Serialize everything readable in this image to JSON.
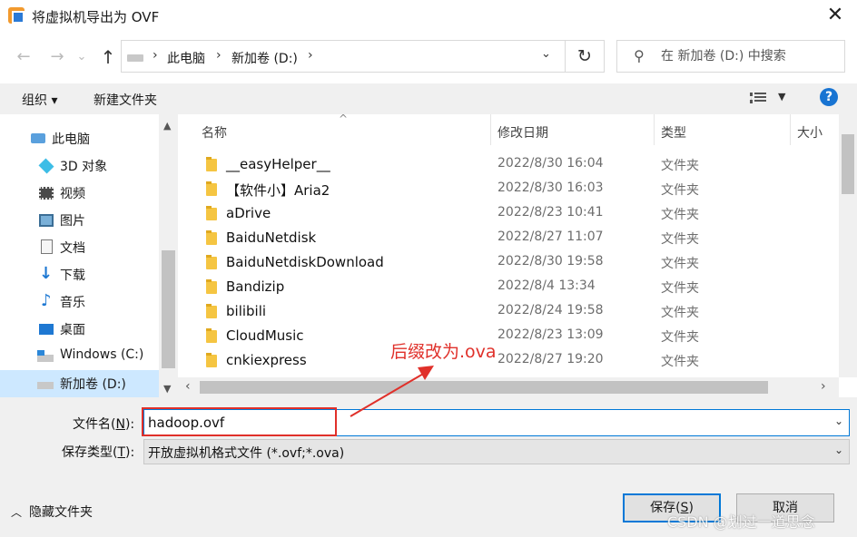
{
  "window": {
    "title": "将虚拟机导出为 OVF",
    "close_glyph": "✕"
  },
  "nav": {
    "back": "←",
    "forward": "→",
    "recent": "⌄",
    "up": "↑",
    "refresh": "↻"
  },
  "address": {
    "crumbs": [
      "此电脑",
      "新加卷 (D:)"
    ],
    "sep": "›"
  },
  "search": {
    "placeholder": "在 新加卷 (D:) 中搜索"
  },
  "toolbar": {
    "organize": "组织 ▾",
    "new_folder": "新建文件夹",
    "help": "?"
  },
  "sidebar": {
    "items": [
      {
        "label": "此电脑",
        "icon": "computer-icon"
      },
      {
        "label": "3D 对象",
        "icon": "cube-icon"
      },
      {
        "label": "视频",
        "icon": "video-icon"
      },
      {
        "label": "图片",
        "icon": "picture-icon"
      },
      {
        "label": "文档",
        "icon": "document-icon"
      },
      {
        "label": "下载",
        "icon": "download-icon"
      },
      {
        "label": "音乐",
        "icon": "music-icon"
      },
      {
        "label": "桌面",
        "icon": "desktop-icon"
      },
      {
        "label": "Windows (C:)",
        "icon": "windows-drive-icon"
      },
      {
        "label": "新加卷 (D:)",
        "icon": "drive-icon",
        "selected": true
      }
    ]
  },
  "columns": {
    "name": "名称",
    "date": "修改日期",
    "type": "类型",
    "size": "大小"
  },
  "files": [
    {
      "name": "__easyHelper__",
      "date": "2022/8/30 16:04",
      "type": "文件夹"
    },
    {
      "name": "【软件小】Aria2",
      "date": "2022/8/30 16:03",
      "type": "文件夹"
    },
    {
      "name": "aDrive",
      "date": "2022/8/23 10:41",
      "type": "文件夹"
    },
    {
      "name": "BaiduNetdisk",
      "date": "2022/8/27 11:07",
      "type": "文件夹"
    },
    {
      "name": "BaiduNetdiskDownload",
      "date": "2022/8/30 19:58",
      "type": "文件夹"
    },
    {
      "name": "Bandizip",
      "date": "2022/8/4 13:34",
      "type": "文件夹"
    },
    {
      "name": "bilibili",
      "date": "2022/8/24 19:58",
      "type": "文件夹"
    },
    {
      "name": "CloudMusic",
      "date": "2022/8/23 13:09",
      "type": "文件夹"
    },
    {
      "name": "cnkiexpress",
      "date": "2022/8/27 19:20",
      "type": "文件夹"
    }
  ],
  "form": {
    "filename_label_pre": "文件名(",
    "filename_label_key": "N",
    "filename_label_post": "):",
    "filename_value": "hadoop.ovf",
    "filetype_label_pre": "保存类型(",
    "filetype_label_key": "T",
    "filetype_label_post": "):",
    "filetype_value": "开放虚拟机格式文件 (*.ovf;*.ova)"
  },
  "footer": {
    "hide_folders": "隐藏文件夹",
    "save_pre": "保存(",
    "save_key": "S",
    "save_post": ")",
    "cancel": "取消"
  },
  "annotation": {
    "text": "后缀改为.ova",
    "color": "#e0302a"
  },
  "watermark": "CSDN @划过一道思念"
}
